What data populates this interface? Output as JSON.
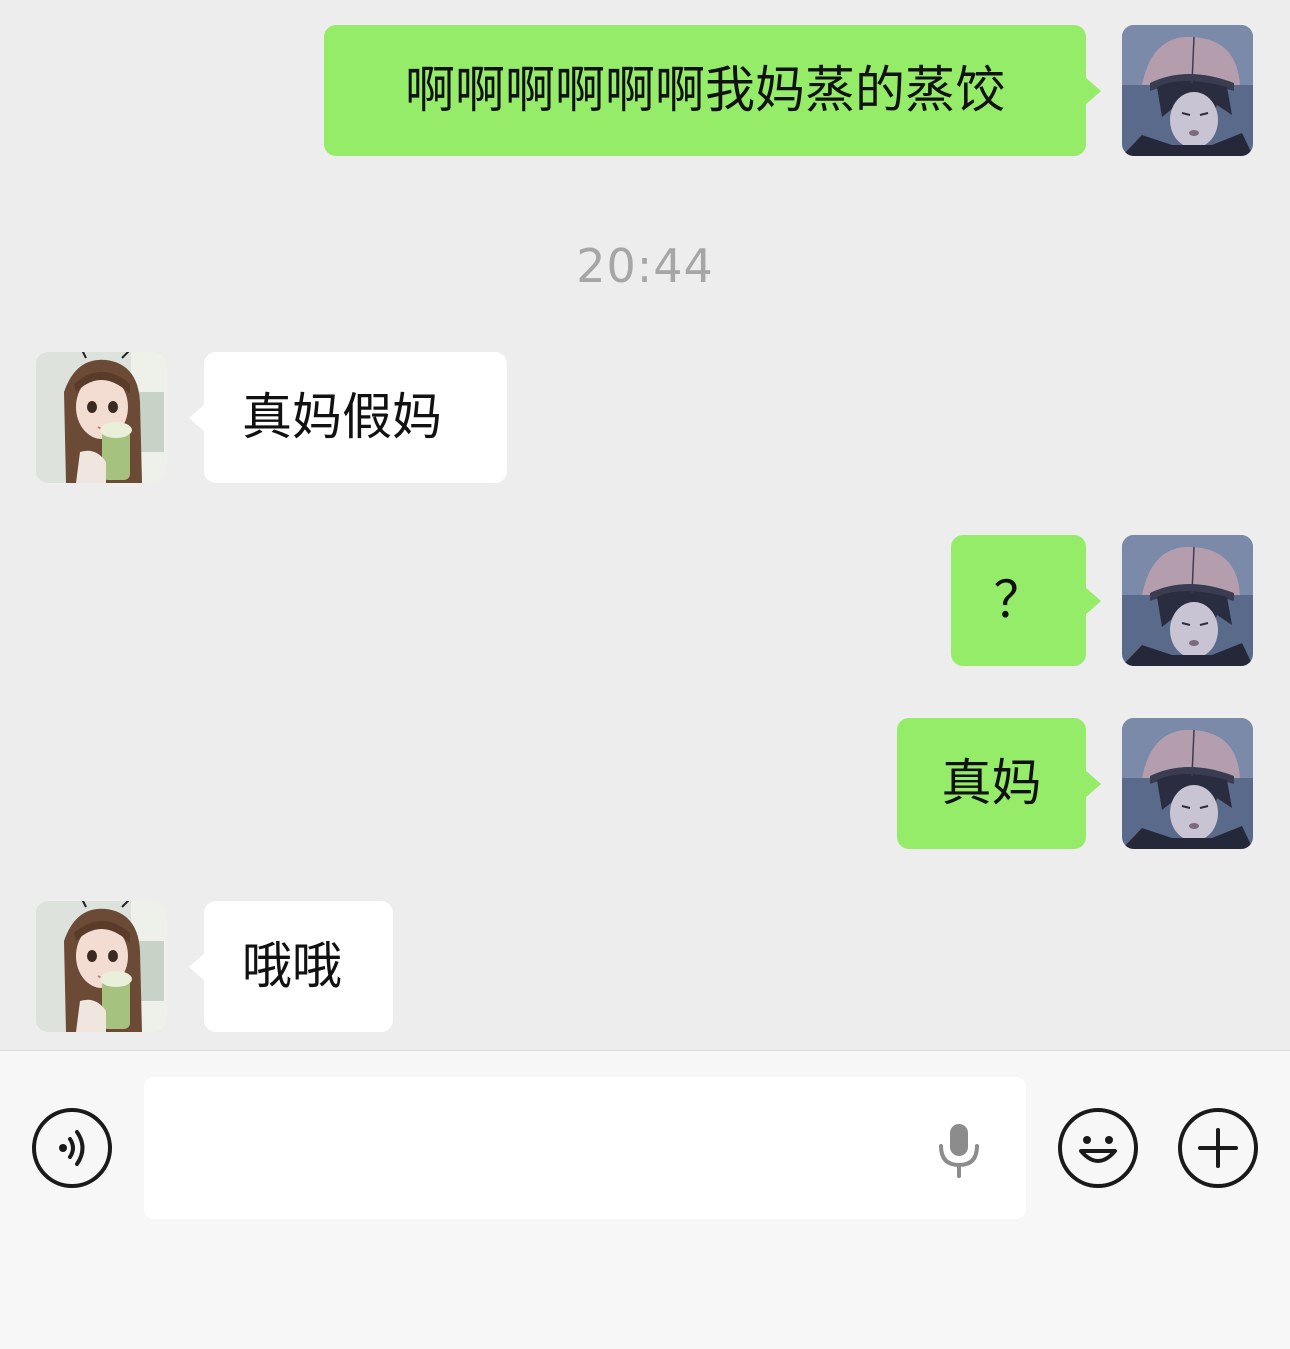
{
  "messages": [
    {
      "sender": "self",
      "text": "啊啊啊啊啊啊我妈蒸的蒸饺"
    },
    {
      "sender": "other",
      "text": "真妈假妈"
    },
    {
      "sender": "self",
      "text": "？"
    },
    {
      "sender": "self",
      "text": "真妈"
    },
    {
      "sender": "other",
      "text": "哦哦"
    }
  ],
  "timestamp": "20:44",
  "input_bar": {
    "placeholder": "",
    "voice_icon": "voice-icon",
    "mic_icon": "microphone-icon",
    "emoji_icon": "emoji-icon",
    "more_icon": "plus-icon"
  },
  "colors": {
    "background": "#ededed",
    "self_bubble": "#95ec69",
    "other_bubble": "#ffffff",
    "timestamp": "#a6a6a6"
  }
}
